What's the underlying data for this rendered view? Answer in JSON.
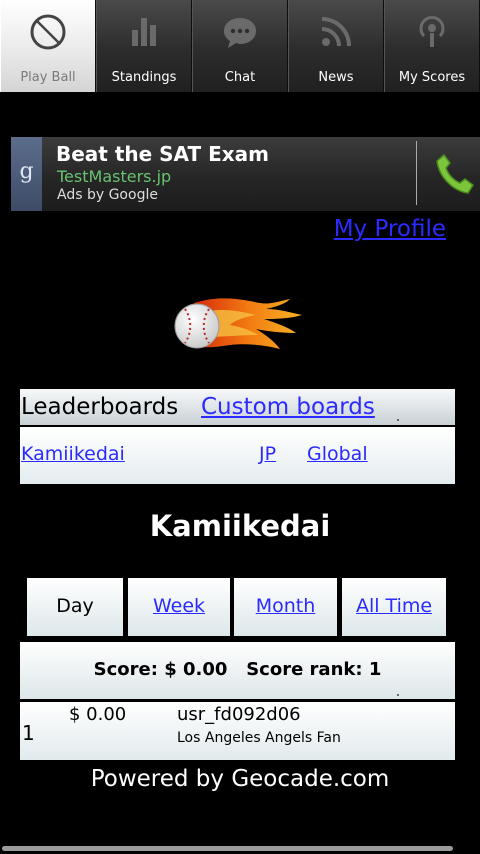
{
  "tabs": [
    {
      "label": "Play Ball",
      "icon": "baseball-icon",
      "active": true
    },
    {
      "label": "Standings",
      "icon": "standings-icon",
      "active": false
    },
    {
      "label": "Chat",
      "icon": "chat-bubble-icon",
      "active": false
    },
    {
      "label": "News",
      "icon": "rss-icon",
      "active": false
    },
    {
      "label": "My Scores",
      "icon": "podcast-icon",
      "active": false
    }
  ],
  "ad": {
    "title": "Beat the SAT Exam",
    "site": "TestMasters.jp",
    "by": "Ads by Google",
    "google_letter": "g",
    "icons": [
      "google-icon",
      "phone-icon"
    ]
  },
  "my_profile": "My Profile",
  "logo_icon": "flaming-baseball-icon",
  "leaderboards": {
    "title": "Leaderboards",
    "custom": "Custom boards",
    "links": [
      "Kamiikedai",
      "JP",
      "Global"
    ]
  },
  "board_name": "Kamiikedai",
  "periods": [
    {
      "label": "Day",
      "active": true
    },
    {
      "label": "Week",
      "active": false
    },
    {
      "label": "Month",
      "active": false
    },
    {
      "label": "All Time",
      "active": false
    }
  ],
  "score_line": "Score: $ 0.00   Score rank: 1",
  "entries": [
    {
      "rank": "1",
      "amount": "$ 0.00",
      "user": "usr_fd092d06",
      "team": "Los Angeles Angels Fan"
    }
  ],
  "powered_by": "Powered by Geocade.com",
  "colors": {
    "link": "#2b2bff",
    "ad_site": "#68c26f",
    "phone": "#7cc43a"
  }
}
